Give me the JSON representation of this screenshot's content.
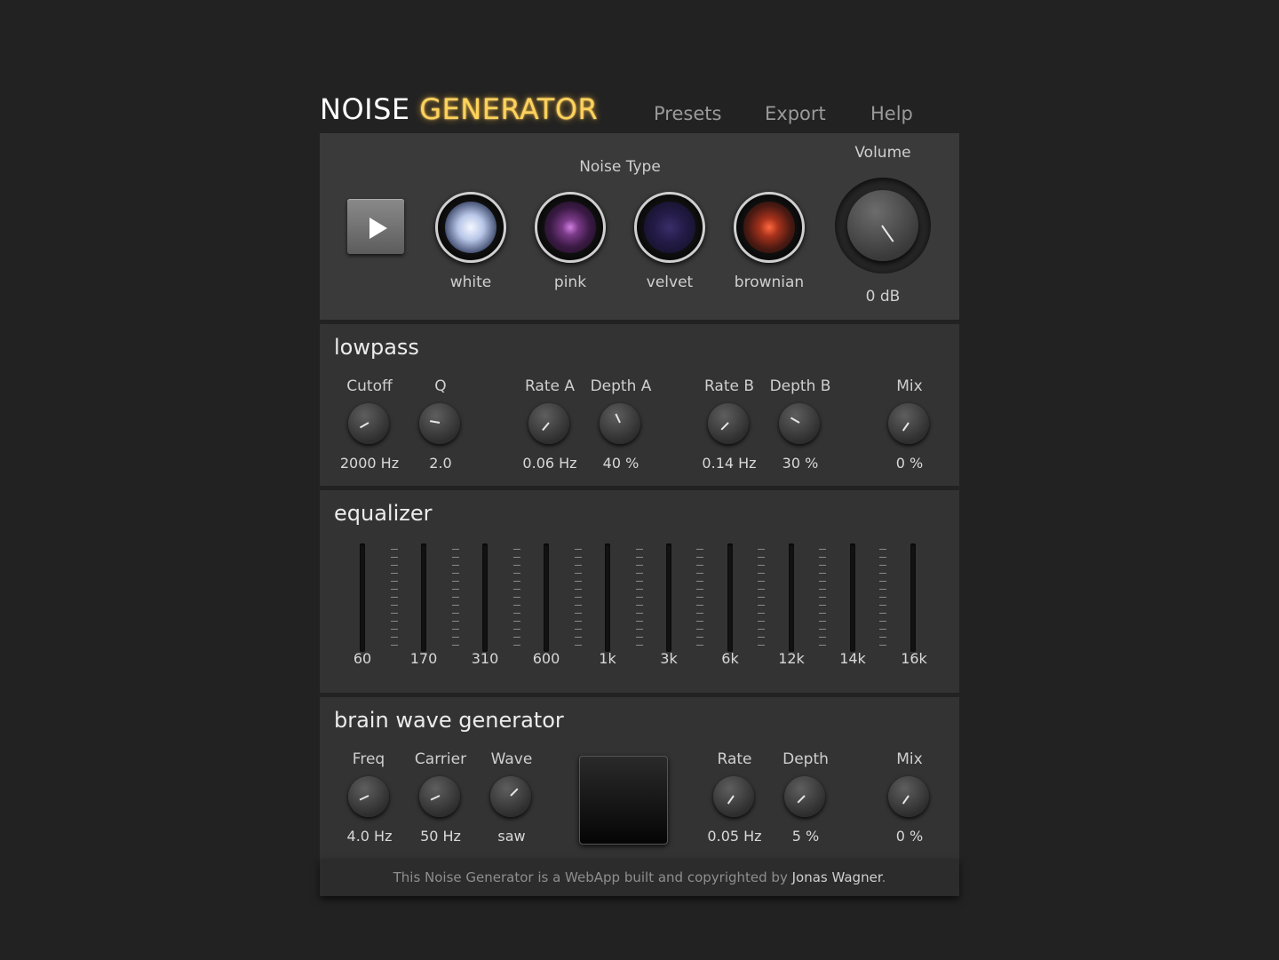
{
  "header": {
    "title_main": "NOISE",
    "title_accent": "GENERATOR",
    "nav": [
      "Presets",
      "Export",
      "Help"
    ]
  },
  "colors": {
    "accent": "#ffd25c",
    "background": "#222222",
    "panel": "#3a3a3a"
  },
  "top": {
    "play_icon": "play-icon",
    "noise_type_label": "Noise Type",
    "noise_types": [
      "white",
      "pink",
      "velvet",
      "brownian"
    ],
    "volume_label": "Volume",
    "volume_value": "0 dB"
  },
  "lowpass": {
    "title": "lowpass",
    "knobs": [
      {
        "label": "Cutoff",
        "value": "2000 Hz"
      },
      {
        "label": "Q",
        "value": "2.0"
      },
      {
        "label": "Rate A",
        "value": "0.06 Hz"
      },
      {
        "label": "Depth A",
        "value": "40 %"
      },
      {
        "label": "Rate B",
        "value": "0.14 Hz"
      },
      {
        "label": "Depth B",
        "value": "30 %"
      },
      {
        "label": "Mix",
        "value": "0 %"
      }
    ]
  },
  "equalizer": {
    "title": "equalizer",
    "bands": [
      "60",
      "170",
      "310",
      "600",
      "1k",
      "3k",
      "6k",
      "12k",
      "14k",
      "16k"
    ]
  },
  "brainwave": {
    "title": "brain wave generator",
    "knobs": [
      {
        "label": "Freq",
        "value": "4.0 Hz"
      },
      {
        "label": "Carrier",
        "value": "50 Hz"
      },
      {
        "label": "Wave",
        "value": "saw"
      },
      {
        "label": "Rate",
        "value": "0.05 Hz"
      },
      {
        "label": "Depth",
        "value": "5 %"
      },
      {
        "label": "Mix",
        "value": "0 %"
      }
    ]
  },
  "footer": {
    "text": "This Noise Generator is a WebApp built and copyrighted by",
    "author": "Jonas Wagner",
    "end": "."
  }
}
